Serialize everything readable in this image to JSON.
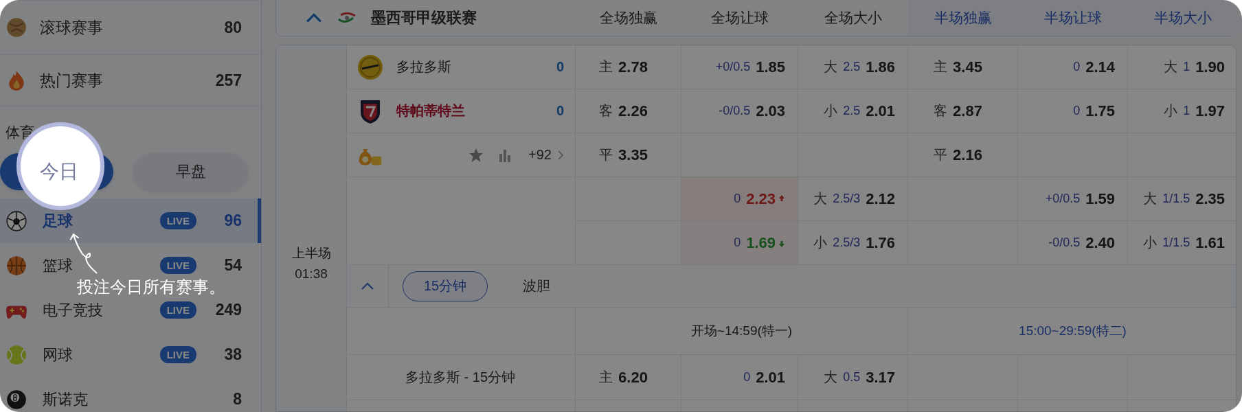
{
  "sidebar": {
    "items": [
      {
        "name": "滚球赛事",
        "count": "80"
      },
      {
        "name": "热门赛事",
        "count": "257"
      }
    ],
    "section_label": "体育",
    "tabs": [
      {
        "label": "今日",
        "selected": true
      },
      {
        "label": "早盘",
        "selected": false
      }
    ],
    "sports": [
      {
        "name": "足球",
        "badge": "LIVE",
        "count": "96",
        "selected": true
      },
      {
        "name": "篮球",
        "badge": "LIVE",
        "count": "54",
        "selected": false
      },
      {
        "name": "电子竞技",
        "badge": "LIVE",
        "count": "249",
        "selected": false
      },
      {
        "name": "网球",
        "badge": "LIVE",
        "count": "38",
        "selected": false
      },
      {
        "name": "斯诺克",
        "count": "8",
        "selected": false
      }
    ]
  },
  "league": {
    "name": "墨西哥甲级联赛",
    "expanded": true
  },
  "columns": [
    {
      "label": "全场独赢",
      "half": false
    },
    {
      "label": "全场让球",
      "half": false
    },
    {
      "label": "全场大小",
      "half": false
    },
    {
      "label": "半场独赢",
      "half": true
    },
    {
      "label": "半场让球",
      "half": true
    },
    {
      "label": "半场大小",
      "half": true
    }
  ],
  "match": {
    "period": "上半场",
    "clock": "01:38",
    "teams": [
      {
        "name": "多拉多斯",
        "score": "0",
        "favorite": false
      },
      {
        "name": "特帕蒂特兰",
        "score": "0",
        "favorite": true
      }
    ],
    "more_count": "+92",
    "rows": [
      [
        {
          "label": "主",
          "odds": "2.78"
        },
        {
          "line": "+0/0.5",
          "odds": "1.85"
        },
        {
          "label": "大",
          "line": "2.5",
          "odds": "1.86"
        },
        {
          "label": "主",
          "odds": "3.45"
        },
        {
          "line": "0",
          "odds": "2.14"
        },
        {
          "label": "大",
          "line": "1",
          "odds": "1.90"
        }
      ],
      [
        {
          "label": "客",
          "odds": "2.26"
        },
        {
          "line": "-0/0.5",
          "odds": "2.03"
        },
        {
          "label": "小",
          "line": "2.5",
          "odds": "2.01"
        },
        {
          "label": "客",
          "odds": "2.87"
        },
        {
          "line": "0",
          "odds": "1.75"
        },
        {
          "label": "小",
          "line": "1",
          "odds": "1.97"
        }
      ],
      [
        {
          "label": "平",
          "odds": "3.35"
        },
        null,
        null,
        {
          "label": "平",
          "odds": "2.16"
        },
        null,
        null
      ],
      [
        null,
        {
          "line": "0",
          "odds": "2.23",
          "rising": true
        },
        {
          "label": "大",
          "line": "2.5/3",
          "odds": "2.12"
        },
        null,
        {
          "line": "+0/0.5",
          "odds": "1.59"
        },
        {
          "label": "大",
          "line": "1/1.5",
          "odds": "2.35"
        }
      ],
      [
        null,
        {
          "line": "0",
          "odds": "1.69",
          "rising": false
        },
        {
          "label": "小",
          "line": "2.5/3",
          "odds": "1.76"
        },
        null,
        {
          "line": "-0/0.5",
          "odds": "2.40"
        },
        {
          "label": "小",
          "line": "1/1.5",
          "odds": "1.61"
        }
      ]
    ]
  },
  "sub_tabs": {
    "expanded": true,
    "tabs": [
      {
        "label": "15分钟",
        "selected": true
      },
      {
        "label": "波胆",
        "selected": false
      }
    ]
  },
  "section": {
    "groups": [
      {
        "label": "开场~14:59(特一)",
        "half": false
      },
      {
        "label": "15:00~29:59(特二)",
        "half": true
      }
    ],
    "rows": [
      {
        "name": "多拉多斯 - 15分钟",
        "cells": [
          {
            "label": "主",
            "odds": "6.20"
          },
          {
            "line": "0",
            "odds": "2.01"
          },
          {
            "label": "大",
            "line": "0.5",
            "odds": "3.17"
          },
          null,
          null,
          null
        ]
      }
    ]
  },
  "tip": {
    "text": "投注今日所有赛事。"
  }
}
